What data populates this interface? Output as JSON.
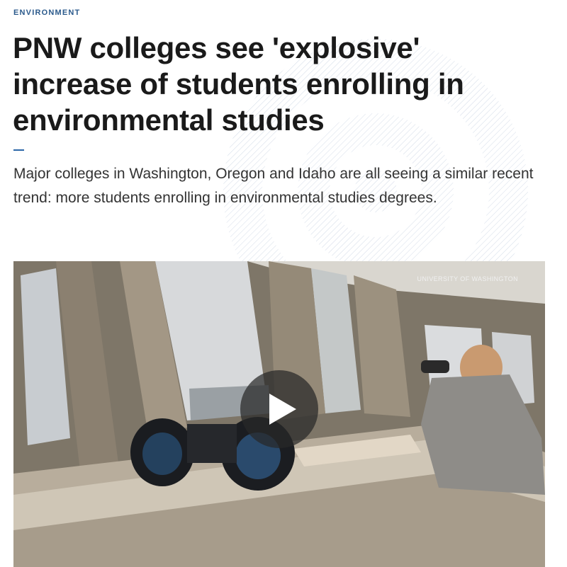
{
  "article": {
    "category": "ENVIRONMENT",
    "headline": "PNW colleges see 'explosive' increase of students enrolling in environmental studies",
    "dek": "Major colleges in Washington, Oregon and Idaho are all seeing a similar recent trend: more students enrolling in environmental studies degrees."
  },
  "video": {
    "credit": "UNIVERSITY OF WASHINGTON",
    "play_icon": "play-icon"
  },
  "colors": {
    "category": "#2b5a8c",
    "accent": "#2b66a8",
    "headline": "#1a1a1a",
    "dek": "#333333"
  }
}
